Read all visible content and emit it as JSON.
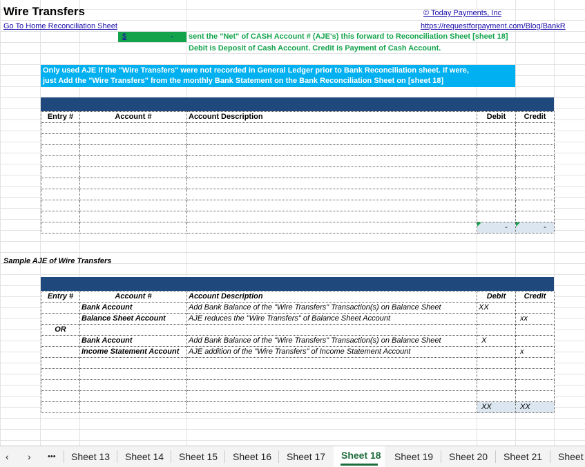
{
  "sheet": {
    "title": "Wire Transfers",
    "home_link": "Go To Home Reconciliation Sheet",
    "company_link": "© Today Payments, Inc",
    "url_link": "https://requestforpayment.com/Blog/BankR",
    "net_cell_currency": "$",
    "net_cell_value": "-",
    "net_note_1": "sent the \"Net\" of CASH Account # (AJE's) this forward to Reconciliation Sheet [sheet 18]",
    "net_note_2": "Debit is Deposit of Cash Account.  Credit is Payment of Cash Account.",
    "info_line_1": "Only used AJE if the \"Wire Transfers\" were not recorded in General Ledger prior to Bank Reconciliation sheet.  If were,",
    "info_line_2": "just Add the \"Wire Transfers\" from the monthly Bank Statement on the Bank Reconciliation Sheet on [sheet 18]",
    "colors": {
      "navy": "#1f497d",
      "cyan": "#00b0f0",
      "green": "#13a34b",
      "total": "#dce6f1"
    }
  },
  "table1": {
    "headers": [
      "Entry #",
      "Account #",
      "Account Description",
      "Debit",
      "Credit"
    ],
    "total_debit": "-",
    "total_credit": "-"
  },
  "sample": {
    "label": "Sample AJE of Wire Transfers",
    "headers": [
      "Entry #",
      "Account #",
      "Account Description",
      "Debit",
      "Credit"
    ],
    "rows": [
      {
        "entry": "",
        "account": "Bank Account",
        "desc": "Add Bank Balance of the \"Wire Transfers\" Transaction(s) on Balance Sheet",
        "debit": "XX",
        "credit": ""
      },
      {
        "entry": "",
        "account": "Balance Sheet Account",
        "desc": "AJE reduces the \"Wire Transfers\" of Balance Sheet Account",
        "debit": "",
        "credit": "xx"
      },
      {
        "entry": "OR",
        "account": "",
        "desc": "",
        "debit": "",
        "credit": ""
      },
      {
        "entry": "",
        "account": "Bank Account",
        "desc": "Add Bank Balance of the \"Wire Transfers\" Transaction(s) on Balance Sheet",
        "debit": "X",
        "credit": ""
      },
      {
        "entry": "",
        "account": "Income Statement Account",
        "desc": "AJE addition of the \"Wire Transfers\" of Income Statement Account",
        "debit": "",
        "credit": "x"
      }
    ],
    "total_debit": "XX",
    "total_credit": "XX"
  },
  "tabs": {
    "more": "•••",
    "items": [
      "Sheet 13",
      "Sheet 14",
      "Sheet 15",
      "Sheet 16",
      "Sheet 17",
      "Sheet 18",
      "Sheet 19",
      "Sheet 20",
      "Sheet 21",
      "Sheet"
    ],
    "active": "Sheet 18"
  }
}
